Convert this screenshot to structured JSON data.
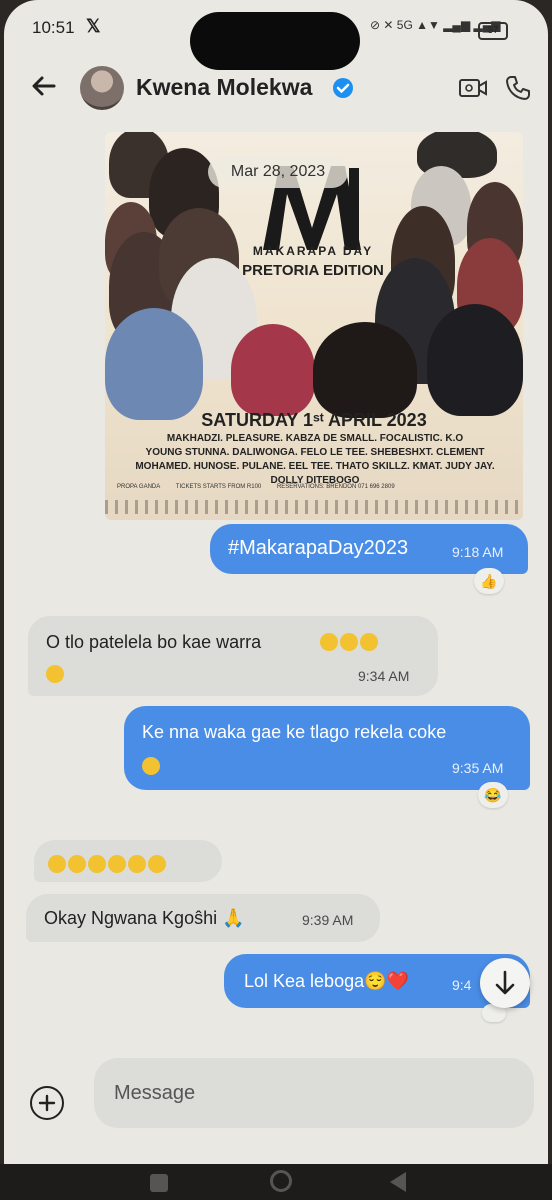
{
  "status_bar": {
    "time": "10:51",
    "x_glyph": "𝕏",
    "indicators": "⊘ ✕ 5G ▲▼ ▂▄▆ ▂▄▆",
    "battery": "37"
  },
  "header": {
    "contact_name": "Kwena Molekwa"
  },
  "conversation": {
    "date_separator": "Mar 28, 2023",
    "poster": {
      "subtitle": "MAKARAPA DAY",
      "edition": "PRETORIA EDITION",
      "event_date": "SATURDAY 1ˢᵗ APRIL 2023",
      "lineup": "MAKHADZI. PLEASURE. KABZA DE SMALL. FOCALISTIC. K.O\nYOUNG STUNNA. DALIWONGA. FELO LE TEE. SHEBESHXT. CLEMENT\nMOHAMED. HUNOSE. PULANE. EEL TEE. THATO SKILLZ. KMAT. JUDY JAY. DOLLY DITEBOGO",
      "footer_left": "PROPA GANDA",
      "footer_middle": "TICKETS STARTS FROM R100",
      "footer_right": "RESERVATIONS: BRENDON 071 696 2809"
    },
    "messages": [
      {
        "text": "#MakarapaDay2023",
        "time": "9:18 AM",
        "reaction": "👍"
      },
      {
        "text": "O tlo patelela bo kae warra",
        "time": "9:34 AM"
      },
      {
        "text": "Ke nna waka gae ke tlago rekela coke",
        "time": "9:35 AM",
        "reaction": "😂"
      },
      {
        "text": "",
        "time": ""
      },
      {
        "text": "Okay Ngwana Kgoŝhi 🙏",
        "time": "9:39 AM"
      },
      {
        "text": "Lol Kea leboga😌❤️",
        "time": "9:4"
      }
    ]
  },
  "composer": {
    "placeholder": "Message"
  }
}
